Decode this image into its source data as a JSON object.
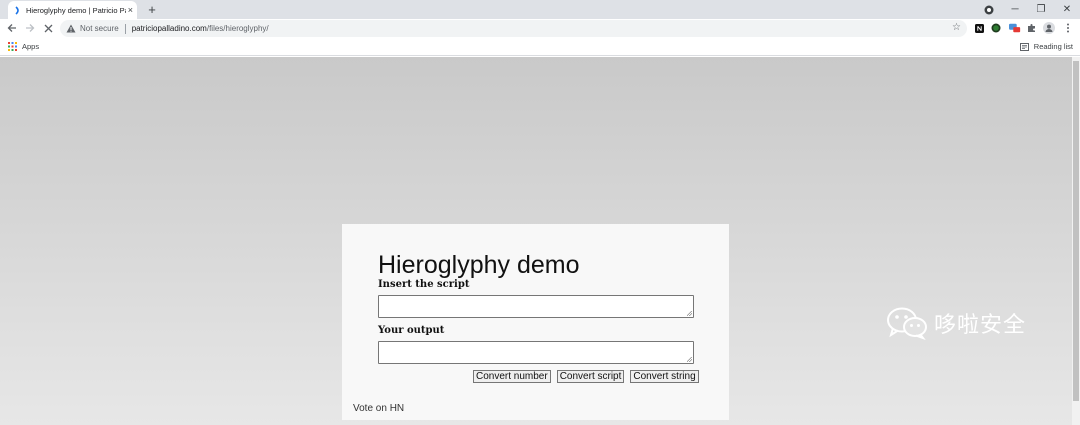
{
  "tab": {
    "title": "Hieroglyphy demo | Patricio Pa",
    "close": "×"
  },
  "new_tab": "+",
  "window": {
    "minimize": "─",
    "restore": "❐",
    "close": "✕"
  },
  "omnibox": {
    "security_status": "Not secure",
    "host": "patriciopalladino.com",
    "path": "/files/hieroglyphy/"
  },
  "bookmarks": {
    "apps_label": "Apps",
    "reading_list_label": "Reading list"
  },
  "page": {
    "title": "Hieroglyphy demo",
    "input_label": "Insert the script",
    "output_label": "Your output",
    "input_value": "",
    "output_value": "",
    "buttons": {
      "convert_number": "Convert number",
      "convert_script": "Convert script",
      "convert_string": "Convert string"
    },
    "vote_link": "Vote on HN"
  },
  "watermark": {
    "text": "哆啦安全"
  }
}
